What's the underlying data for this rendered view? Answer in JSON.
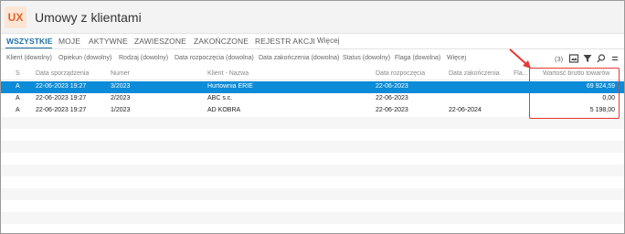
{
  "app": {
    "logo": "UX",
    "title": "Umowy z klientami"
  },
  "tabs": [
    "WSZYSTKIE",
    "MOJE",
    "AKTYWNE",
    "ZAWIESZONE",
    "ZAKOŃCZONE",
    "REJESTR AKCJI",
    "Więcej"
  ],
  "filters": [
    "Klient (dowolny)",
    "Opiekun (dowolny)",
    "Rodzaj (dowolny)",
    "Data rozpoczęcia (dowolna)",
    "Data zakończenia (dowolna)",
    "Status (dowolny)",
    "Flaga (dowolna)",
    "Więcej"
  ],
  "toolbar": {
    "count": "(3)"
  },
  "table": {
    "columns": [
      "S",
      "Data sporządzenia",
      "Numer",
      "Klient - Nazwa",
      "Data rozpoczęcia",
      "Data zakończenia",
      "Fla...",
      "Wartość brutto towarów"
    ],
    "rows": [
      [
        "A",
        "22-06-2023 19:27",
        "3/2023",
        "Hurtownia ERIE",
        "22-06-2023",
        "",
        "",
        "69 924,59"
      ],
      [
        "A",
        "22-06-2023 19:27",
        "2/2023",
        "ABC s.c.",
        "22-06-2023",
        "",
        "",
        "0,00"
      ],
      [
        "A",
        "22-06-2023 19:27",
        "1/2023",
        "AD KOBRA",
        "22-06-2023",
        "22-06-2024",
        "",
        "5 198,00"
      ]
    ]
  },
  "colors": {
    "accent": "#1d6fa6",
    "selected_row": "#0c8bd8",
    "highlight": "#e53935",
    "logo": "#e0642a"
  },
  "icons": [
    "export-icon",
    "filter-icon",
    "search-icon",
    "menu-icon",
    "arrow-annotation"
  ]
}
